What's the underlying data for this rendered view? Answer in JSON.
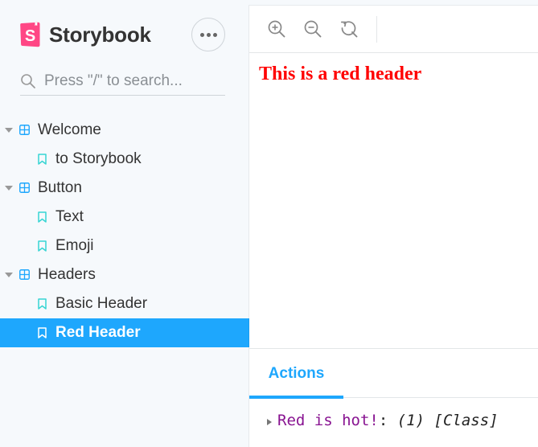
{
  "sidebar": {
    "brand": {
      "name": "Storybook",
      "logo_letter": "S",
      "logo_color": "#ff4785"
    },
    "menu_icon": "ellipsis-icon",
    "search": {
      "placeholder": "Press \"/\" to search...",
      "value": ""
    },
    "tree": [
      {
        "type": "group",
        "label": "Welcome",
        "expanded": true
      },
      {
        "type": "story",
        "label": "to Storybook",
        "selected": false
      },
      {
        "type": "group",
        "label": "Button",
        "expanded": true
      },
      {
        "type": "story",
        "label": "Text",
        "selected": false
      },
      {
        "type": "story",
        "label": "Emoji",
        "selected": false
      },
      {
        "type": "group",
        "label": "Headers",
        "expanded": true
      },
      {
        "type": "story",
        "label": "Basic Header",
        "selected": false
      },
      {
        "type": "story",
        "label": "Red Header",
        "selected": true
      }
    ]
  },
  "toolbar": {
    "tools": [
      "zoom-in-icon",
      "zoom-out-icon",
      "reset-zoom-icon"
    ]
  },
  "preview": {
    "header_text": "This is a red header",
    "header_color": "#ff0000"
  },
  "addons": {
    "active_tab": "Actions",
    "log": [
      {
        "name": "Red is hot!",
        "separator": ":",
        "args": "(1) [Class]"
      }
    ]
  },
  "colors": {
    "accent": "#1ea7fd",
    "sidebar_bg": "#f6f9fc",
    "group_icon": "#1ea7fd",
    "story_icon": "#37d5d3"
  }
}
